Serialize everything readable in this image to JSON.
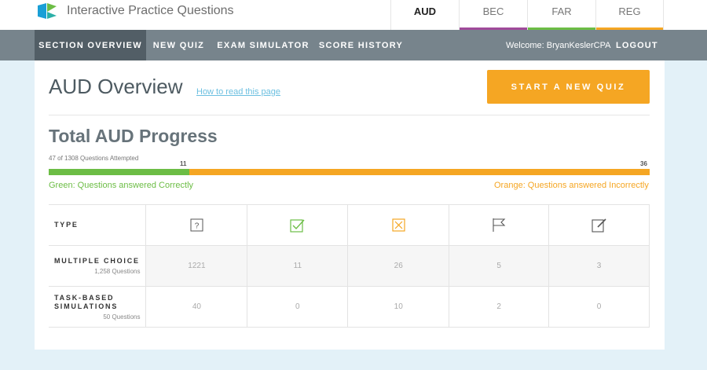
{
  "app": {
    "title": "Interactive Practice Questions"
  },
  "sections": [
    {
      "label": "AUD",
      "color": "#ffffff",
      "active": true
    },
    {
      "label": "BEC",
      "color": "#a04a9a",
      "active": false
    },
    {
      "label": "FAR",
      "color": "#6cbd45",
      "active": false
    },
    {
      "label": "REG",
      "color": "#f5a623",
      "active": false
    }
  ],
  "nav": {
    "items": [
      "SECTION OVERVIEW",
      "NEW QUIZ",
      "EXAM SIMULATOR",
      "SCORE HISTORY"
    ],
    "welcome": "Welcome: BryanKeslerCPA",
    "logout": "LOGOUT"
  },
  "overview": {
    "title": "AUD Overview",
    "help_link": "How to read this page",
    "start_button": "START A NEW QUIZ"
  },
  "progress": {
    "title": "Total AUD Progress",
    "attempted_text": "47 of 1308 Questions Attempted",
    "correct": 11,
    "incorrect": 36,
    "correct_label": "11",
    "incorrect_label": "36",
    "correct_fraction": 0.234,
    "legend_correct": "Green: Questions answered Correctly",
    "legend_incorrect": "Orange: Questions answered Incorrectly"
  },
  "table": {
    "type_header": "TYPE",
    "columns": [
      {
        "icon": "question-icon"
      },
      {
        "icon": "check-icon"
      },
      {
        "icon": "x-icon"
      },
      {
        "icon": "flag-icon"
      },
      {
        "icon": "note-icon"
      }
    ],
    "rows": [
      {
        "name": "MULTIPLE CHOICE",
        "sub": "1,258 Questions",
        "values": [
          "1221",
          "11",
          "26",
          "5",
          "3"
        ]
      },
      {
        "name": "TASK-BASED SIMULATIONS",
        "sub": "50 Questions",
        "values": [
          "40",
          "0",
          "10",
          "2",
          "0"
        ]
      }
    ]
  },
  "colors": {
    "green": "#6cbd45",
    "orange": "#f5a623",
    "nav": "#77848c",
    "nav_active": "#525e66"
  }
}
